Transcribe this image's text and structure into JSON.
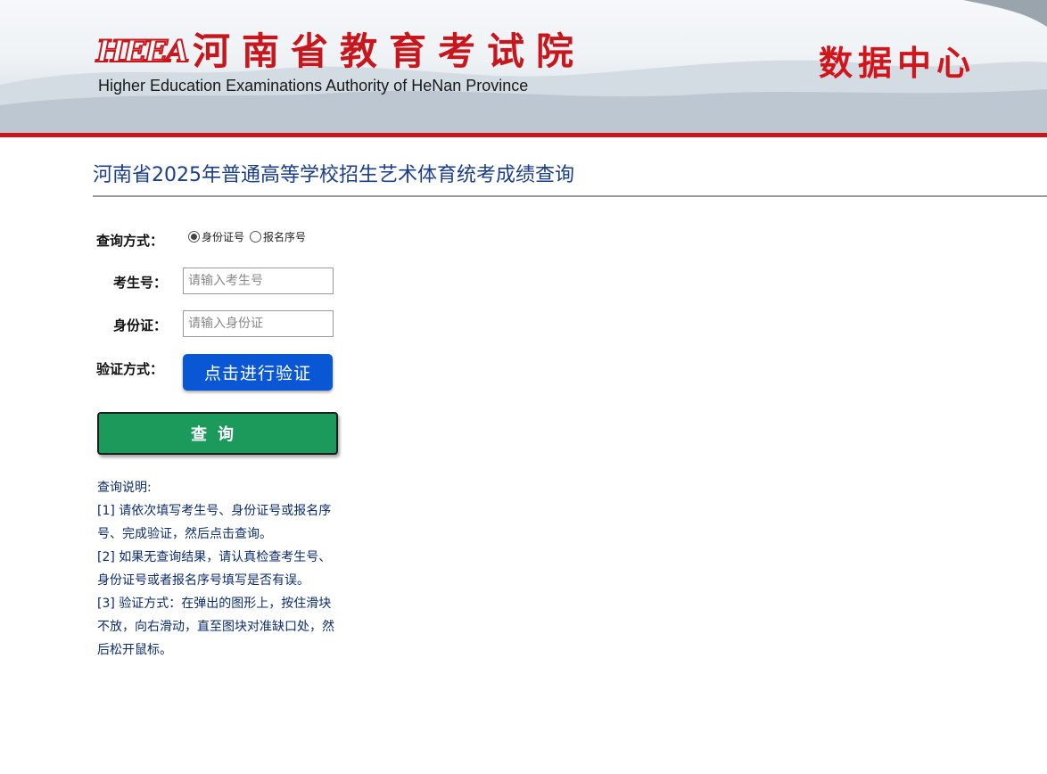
{
  "header": {
    "logo_mark": "HEEA",
    "title": "河南省教育考试院",
    "subtitle": "Higher Education Examinations Authority of HeNan Province",
    "data_center": "数据中心"
  },
  "page_title": "河南省2025年普通高等学校招生艺术体育统考成绩查询",
  "form": {
    "query_mode_label": "查询方式：",
    "query_mode_options": [
      "身份证号",
      "报名序号"
    ],
    "query_mode_selected": "身份证号",
    "exam_no_label": "考生号：",
    "exam_no_placeholder": "请输入考生号",
    "id_card_label": "身份证：",
    "id_card_placeholder": "请输入身份证",
    "verify_label": "验证方式：",
    "verify_button": "点击进行验证",
    "query_button": "查询"
  },
  "notes": {
    "heading": "查询说明:",
    "items": [
      "[1] 请依次填写考生号、身份证号或报名序号、完成验证，然后点击查询。",
      "[2] 如果无查询结果，请认真检查考生号、身份证号或者报名序号填写是否有误。",
      "[3] 验证方式：在弹出的图形上，按住滑块不放，向右滑动，直至图块对准缺口处，然后松开鼠标。"
    ]
  },
  "colors": {
    "brand_red": "#c8161d",
    "title_blue": "#1b3e8a",
    "verify_blue": "#0a57d6",
    "query_green": "#1c9a5c",
    "notes_blue": "#0b2c6e"
  }
}
